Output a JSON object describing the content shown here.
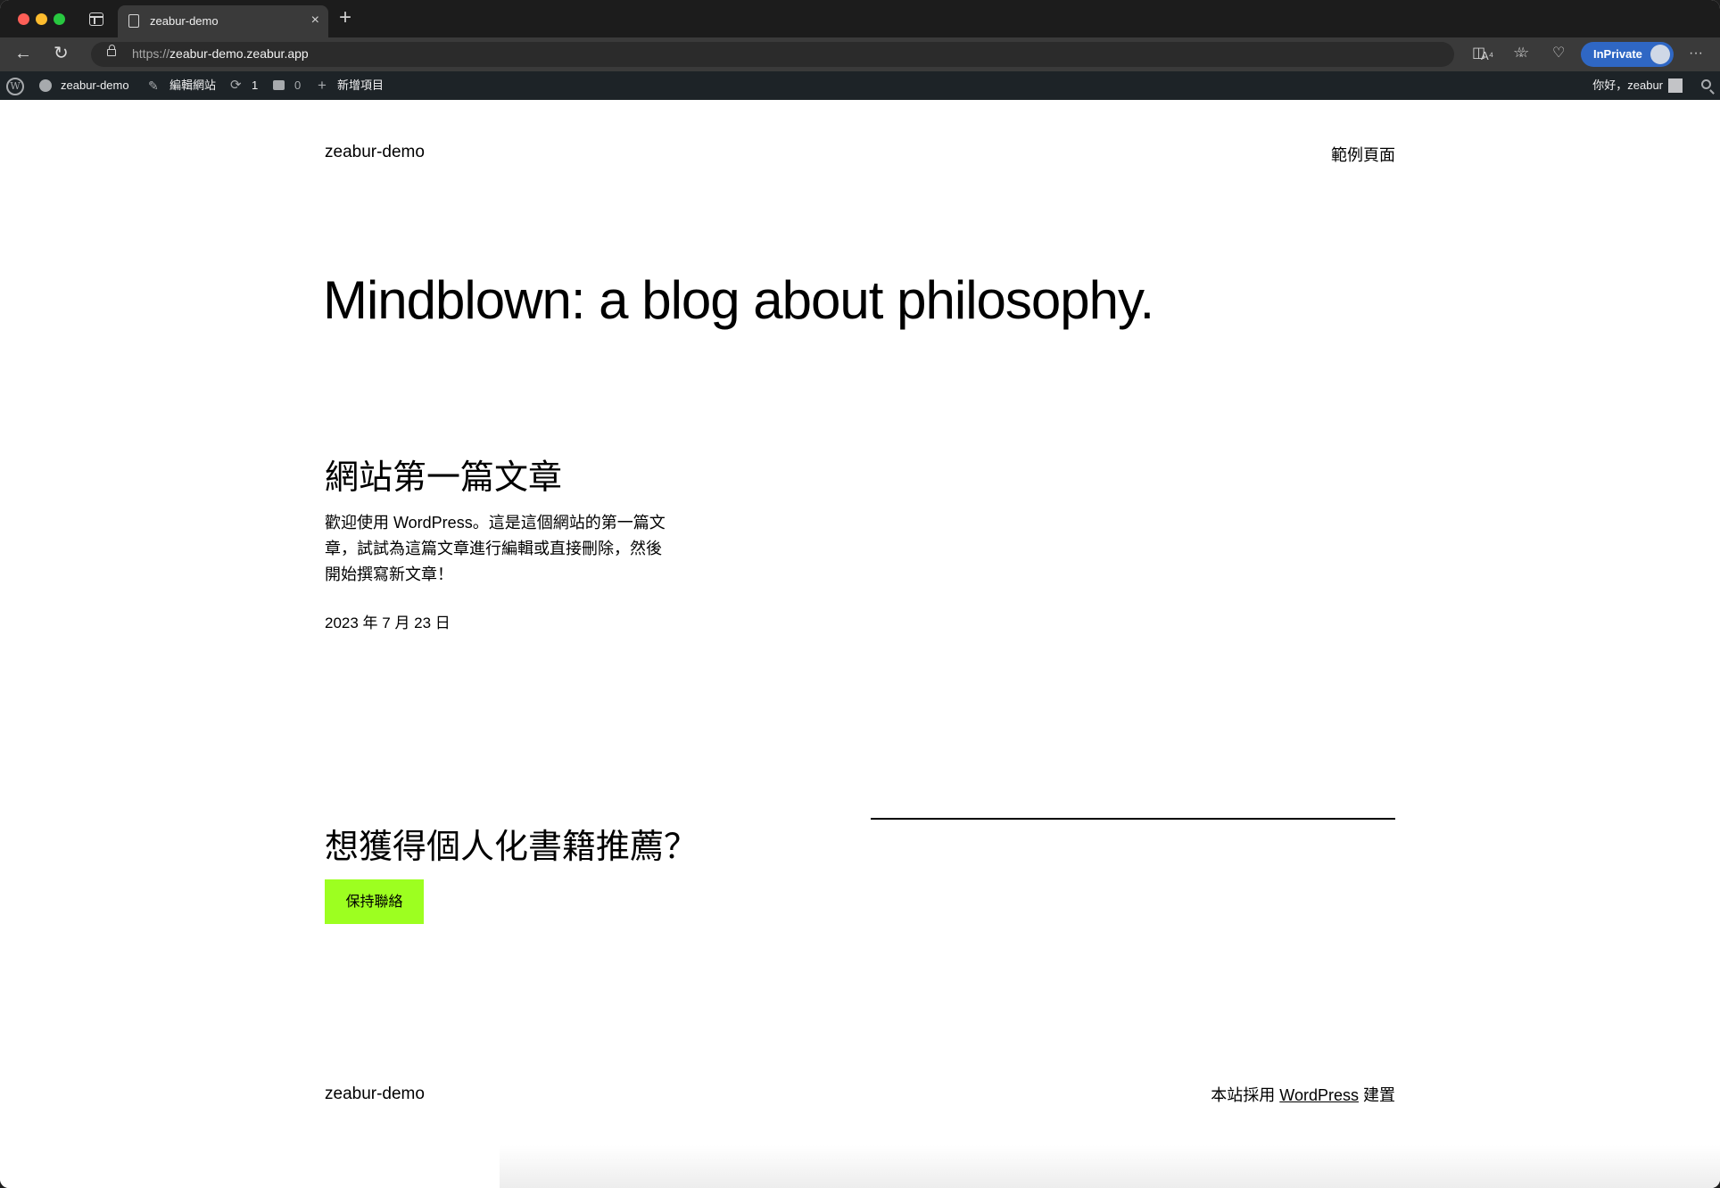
{
  "browser": {
    "tab_title": "zeabur-demo",
    "tab_close": "×",
    "new_tab": "+",
    "url_protocol": "https://",
    "url_host": "zeabur-demo.zeabur.app",
    "inprivate_label": "InPrivate",
    "read_aloud_icon": "A⁴",
    "more_icon": "···"
  },
  "adminbar": {
    "site_name": "zeabur-demo",
    "edit_site": "編輯網站",
    "updates_count": "1",
    "comments_count": "0",
    "new_item": "新增項目",
    "howdy": "你好，zeabur"
  },
  "site": {
    "title": "zeabur-demo",
    "nav_link": "範例頁面",
    "hero_heading": "Mindblown: a blog about philosophy."
  },
  "post": {
    "title": "網站第一篇文章",
    "excerpt": "歡迎使用 WordPress。這是這個網站的第一篇文章，試試為這篇文章進行編輯或直接刪除，然後開始撰寫新文章！",
    "date": "2023 年 7 月 23 日"
  },
  "cta": {
    "heading": "想獲得個人化書籍推薦？",
    "button_label": "保持聯絡"
  },
  "footer": {
    "title": "zeabur-demo",
    "credit_prefix": "本站採用 ",
    "credit_link": "WordPress",
    "credit_suffix": " 建置"
  },
  "colors": {
    "cta_button_bg": "#9dff20",
    "admin_bar_bg": "#1d2327",
    "inprivate_bg": "#2f67c4"
  }
}
